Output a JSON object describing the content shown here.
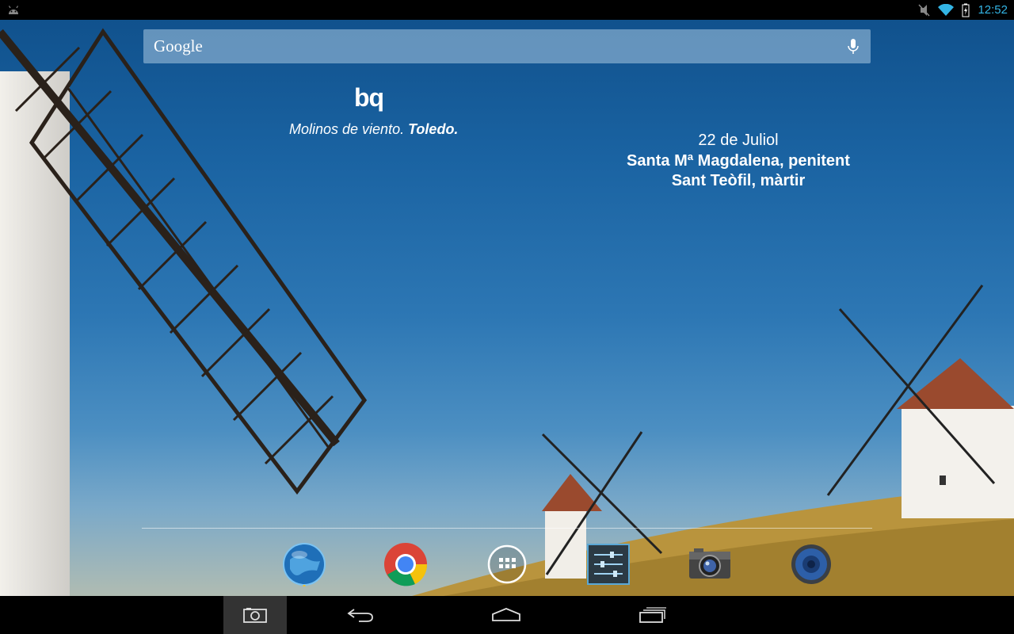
{
  "status_bar": {
    "time": "12:52",
    "left_icon": "android-debug-icon",
    "right_icons": [
      "mute-icon",
      "wifi-icon",
      "battery-charging-icon"
    ],
    "accent_color": "#33b5e5"
  },
  "search": {
    "logo_text": "Google",
    "mic_icon": "mic-icon"
  },
  "wallpaper_widget": {
    "brand": "bq",
    "caption_normal": "Molinos de viento.",
    "caption_bold": "Toledo."
  },
  "saints_widget": {
    "date": "22 de Juliol",
    "saints": [
      "Santa Mª Magdalena, penitent",
      "Sant Teòfil, màrtir"
    ]
  },
  "dock": {
    "apps": [
      {
        "name": "globe-app-icon"
      },
      {
        "name": "chrome-icon"
      },
      {
        "name": "all-apps-icon"
      },
      {
        "name": "settings-icon"
      },
      {
        "name": "camera-icon"
      },
      {
        "name": "speaker-icon"
      }
    ]
  },
  "nav_bar": {
    "buttons": [
      "screenshot-icon",
      "back-icon",
      "home-icon",
      "recent-apps-icon"
    ]
  }
}
